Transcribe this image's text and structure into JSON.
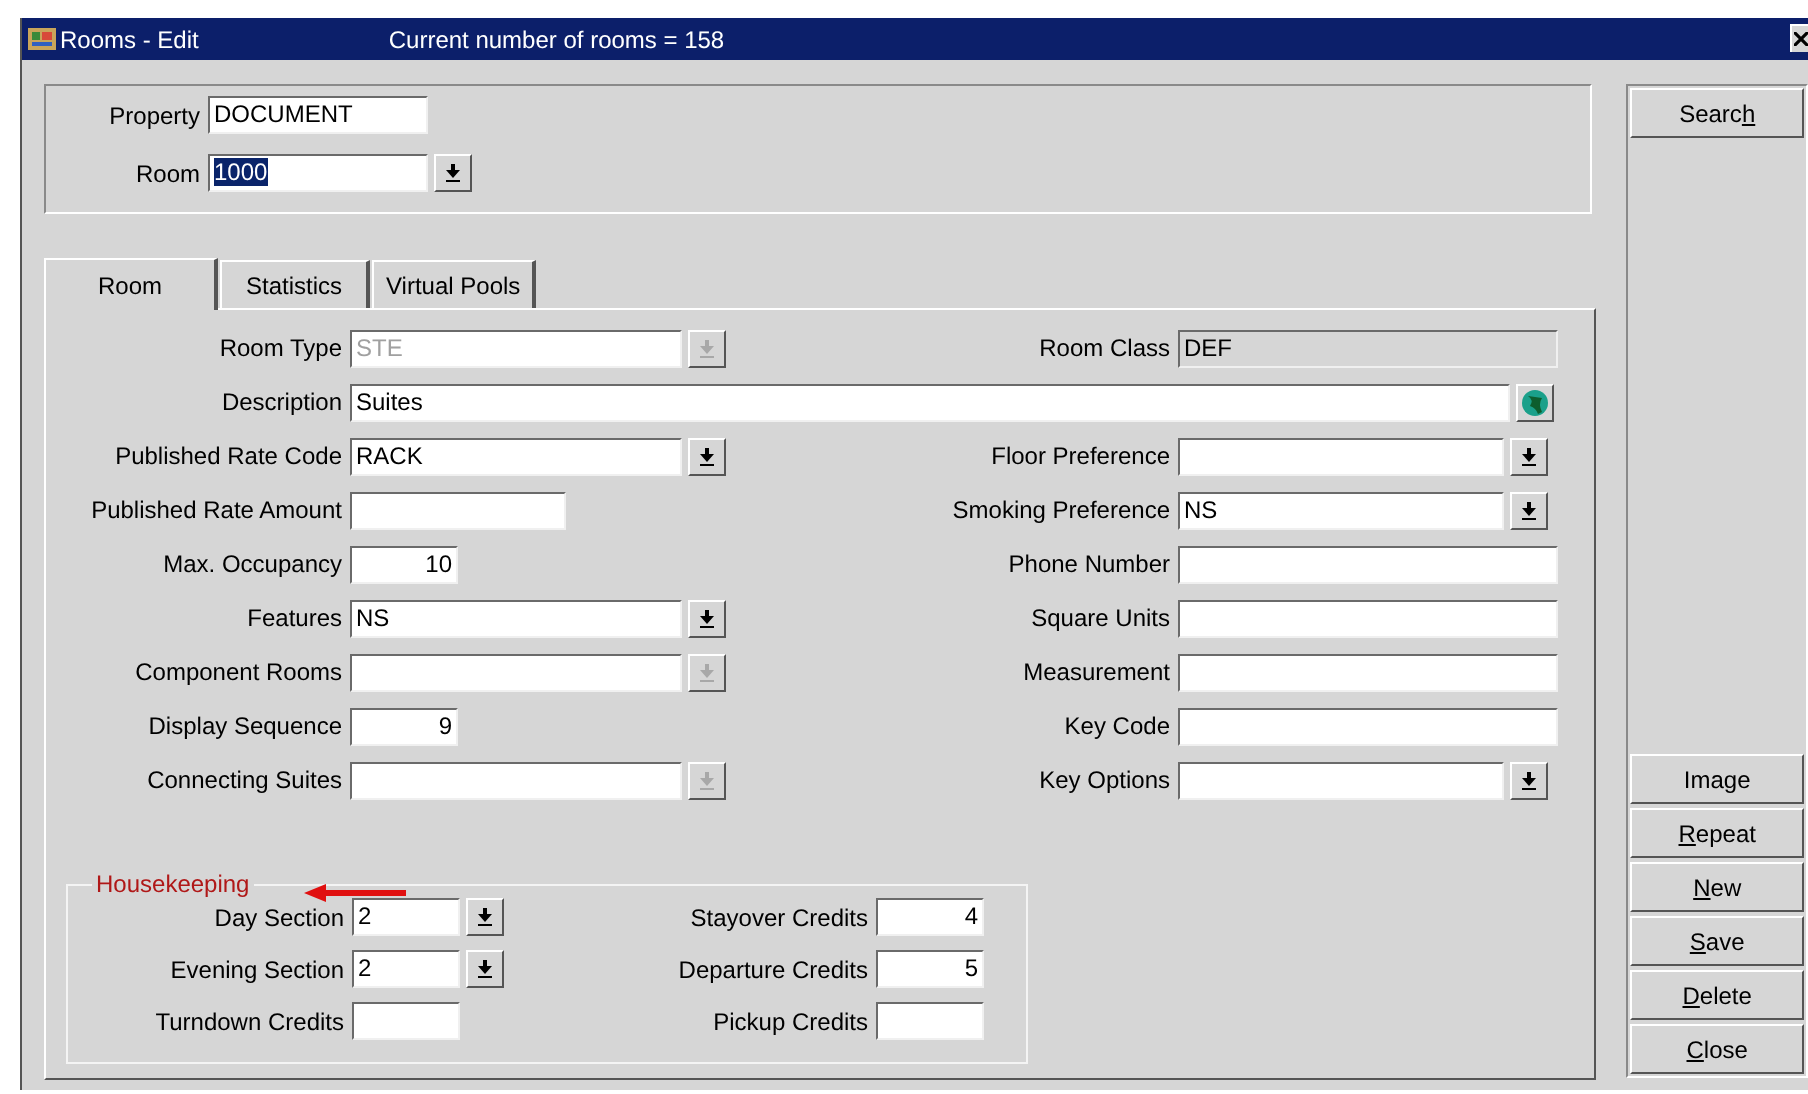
{
  "window": {
    "title": "Rooms - Edit",
    "subtitle": "Current number of rooms = 158"
  },
  "header_fields": [
    {
      "label": "Property",
      "kind": "text",
      "value": "DOCUMENT",
      "text_selected": false
    },
    {
      "label": "Room",
      "kind": "dropdown",
      "value": "1000",
      "text_selected": true,
      "disabled": false
    }
  ],
  "tabs": [
    {
      "label": "Room",
      "selected": true
    },
    {
      "label": "Statistics",
      "selected": false
    },
    {
      "label": "Virtual Pools",
      "selected": false
    }
  ],
  "rows": [
    {
      "left": {
        "label": "Room Type",
        "kind": "dropdown",
        "value": "STE",
        "disabled": true
      },
      "right": {
        "label": "Room Class",
        "kind": "readonly",
        "value": "DEF"
      }
    },
    {
      "left": {
        "label": "Description",
        "kind": "lookup",
        "value": "Suites"
      }
    },
    {
      "left": {
        "label": "Published Rate Code",
        "kind": "dropdown",
        "value": "RACK",
        "disabled": false
      },
      "right": {
        "label": "Floor Preference",
        "kind": "dropdown",
        "disabled": false
      }
    },
    {
      "left": {
        "label": "Published Rate Amount",
        "kind": "text"
      },
      "right": {
        "label": "Smoking Preference",
        "kind": "dropdown",
        "value": "NS",
        "disabled": false
      }
    },
    {
      "left": {
        "label": "Max. Occupancy",
        "kind": "number",
        "value": "10"
      },
      "right": {
        "label": "Phone Number",
        "kind": "text"
      }
    },
    {
      "left": {
        "label": "Features",
        "kind": "dropdown",
        "value": "NS",
        "disabled": false
      },
      "right": {
        "label": "Square Units",
        "kind": "text"
      }
    },
    {
      "left": {
        "label": "Component Rooms",
        "kind": "dropdown",
        "disabled": true
      },
      "right": {
        "label": "Measurement",
        "kind": "text"
      }
    },
    {
      "left": {
        "label": "Display Sequence",
        "kind": "number",
        "value": "9"
      },
      "right": {
        "label": "Key Code",
        "kind": "text"
      }
    },
    {
      "left": {
        "label": "Connecting Suites",
        "kind": "dropdown",
        "disabled": true
      },
      "right": {
        "label": "Key Options",
        "kind": "dropdown",
        "disabled": false
      }
    }
  ],
  "housekeeping": {
    "title": "Housekeeping",
    "rows": [
      {
        "left": {
          "label": "Day Section",
          "kind": "dropdown",
          "value": "2",
          "disabled": false
        },
        "right": {
          "label": "Stayover Credits",
          "kind": "number",
          "value": "4"
        }
      },
      {
        "left": {
          "label": "Evening Section",
          "kind": "dropdown",
          "value": "2",
          "disabled": false
        },
        "right": {
          "label": "Departure Credits",
          "kind": "number",
          "value": "5"
        }
      },
      {
        "left": {
          "label": "Turndown Credits",
          "kind": "text"
        },
        "right": {
          "label": "Pickup Credits",
          "kind": "text"
        }
      }
    ]
  },
  "buttons": {
    "top": [
      {
        "before": "Searc",
        "key": "h"
      }
    ],
    "bottom": [
      {
        "before": "Image"
      },
      {
        "key": "R",
        "after": "epeat"
      },
      {
        "key": "N",
        "after": "ew"
      },
      {
        "key": "S",
        "after": "ave"
      },
      {
        "key": "D",
        "after": "elete"
      },
      {
        "key": "C",
        "after": "lose"
      }
    ]
  }
}
